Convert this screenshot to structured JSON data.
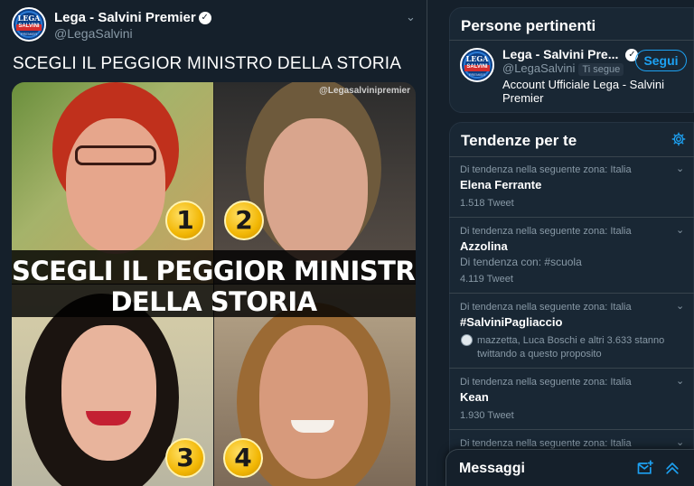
{
  "tweet": {
    "author_name": "Lega - Salvini Premier",
    "handle": "@LegaSalvini",
    "text": "SCEGLI IL PEGGIOR MINISTRO DELLA STORIA",
    "avatar_text": {
      "top": "LEGA",
      "middle": "SALVINI",
      "bottom": "PREMIER"
    },
    "media": {
      "watermark": "@Legasalvinipremier",
      "banner_line1": "SCEGLI IL PEGGIOR MINISTRO",
      "banner_line2": "DELLA STORIA",
      "numbers": [
        "1",
        "2",
        "3",
        "4"
      ]
    }
  },
  "people": {
    "title": "Persone pertinenti",
    "account": {
      "name": "Lega - Salvini Pre...",
      "handle": "@LegaSalvini",
      "follows_you_badge": "Ti segue",
      "follow_label": "Segui",
      "bio": "Account Ufficiale Lega - Salvini Premier"
    }
  },
  "trends": {
    "title": "Tendenze per te",
    "items": [
      {
        "context": "Di tendenza nella seguente zona: Italia",
        "name": "Elena Ferrante",
        "count": "1.518 Tweet"
      },
      {
        "context": "Di tendenza nella seguente zona: Italia",
        "name": "Azzolina",
        "extra": "Di tendenza con: #scuola",
        "count": "4.119 Tweet"
      },
      {
        "context": "Di tendenza nella seguente zona: Italia",
        "name": "#SalviniPagliaccio",
        "people": "mazzetta, Luca Boschi e altri 3.633 stanno twittando a questo proposito"
      },
      {
        "context": "Di tendenza nella seguente zona: Italia",
        "name": "Kean",
        "count": "1.930 Tweet"
      },
      {
        "context": "Di tendenza nella seguente zona: Italia"
      }
    ]
  },
  "messages": {
    "title": "Messaggi"
  },
  "colors": {
    "background": "#15202b",
    "accent": "#1da1f2",
    "muted": "#8899a6",
    "card": "#192734"
  }
}
